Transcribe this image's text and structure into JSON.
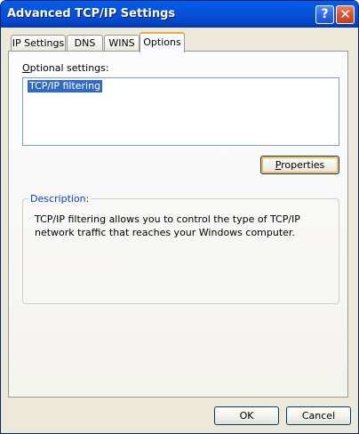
{
  "window": {
    "title": "Advanced TCP/IP Settings",
    "help_glyph": "?",
    "close_glyph": "✕"
  },
  "tabs": [
    {
      "label": "IP Settings",
      "active": false
    },
    {
      "label": "DNS",
      "active": false
    },
    {
      "label": "WINS",
      "active": false
    },
    {
      "label": "Options",
      "active": true
    }
  ],
  "options": {
    "label_first": "O",
    "label_rest": "ptional settings:",
    "items": [
      "TCP/IP filtering"
    ],
    "selected_index": 0,
    "properties_first": "P",
    "properties_rest": "roperties"
  },
  "description": {
    "legend": "Description:",
    "text": "TCP/IP filtering allows you to control the type of TCP/IP network traffic that reaches your Windows computer."
  },
  "footer": {
    "ok_label": "OK",
    "cancel_label": "Cancel"
  },
  "colors": {
    "titlebar": "#0058e6",
    "selection": "#316ac5",
    "group_legend": "#0046d5",
    "active_tab_accent": "#f0a83c"
  }
}
